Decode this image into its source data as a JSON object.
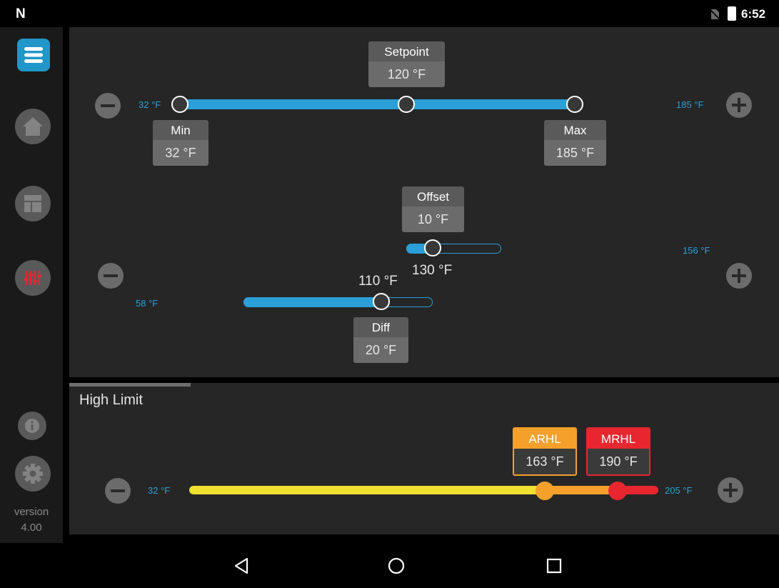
{
  "status_bar": {
    "time": "6:52"
  },
  "sidebar": {
    "menu_icon": "menu-icon",
    "items": [
      {
        "name": "home",
        "icon": "home-icon"
      },
      {
        "name": "dashboard",
        "icon": "dashboard-icon"
      },
      {
        "name": "controls",
        "icon": "sliders-icon"
      },
      {
        "name": "info",
        "icon": "info-icon"
      },
      {
        "name": "settings",
        "icon": "gear-icon"
      }
    ],
    "version_label": "version",
    "version_value": "4.00"
  },
  "setpoint_section": {
    "min_label": "32 °F",
    "max_label": "185 °F",
    "setpoint": {
      "title": "Setpoint",
      "value": "120 °F"
    },
    "min": {
      "title": "Min",
      "value": "32 °F"
    },
    "max": {
      "title": "Max",
      "value": "185 °F"
    }
  },
  "offset_section": {
    "right_label": "156 °F",
    "left_label": "58 °F",
    "offset": {
      "title": "Offset",
      "value": "10 °F"
    },
    "offset_temp": "130 °F",
    "diff_temp": "110 °F",
    "diff": {
      "title": "Diff",
      "value": "20 °F"
    }
  },
  "high_limit": {
    "title": "High Limit",
    "min_label": "32 °F",
    "max_label": "205 °F",
    "arhl": {
      "title": "ARHL",
      "value": "163 °F"
    },
    "mrhl": {
      "title": "MRHL",
      "value": "190 °F"
    }
  },
  "colors": {
    "accent_blue": "#2196c8",
    "track_blue": "#2a9fd8",
    "track_yellow": "#f0e030",
    "track_orange": "#f5a02a",
    "track_red": "#e8262f"
  }
}
